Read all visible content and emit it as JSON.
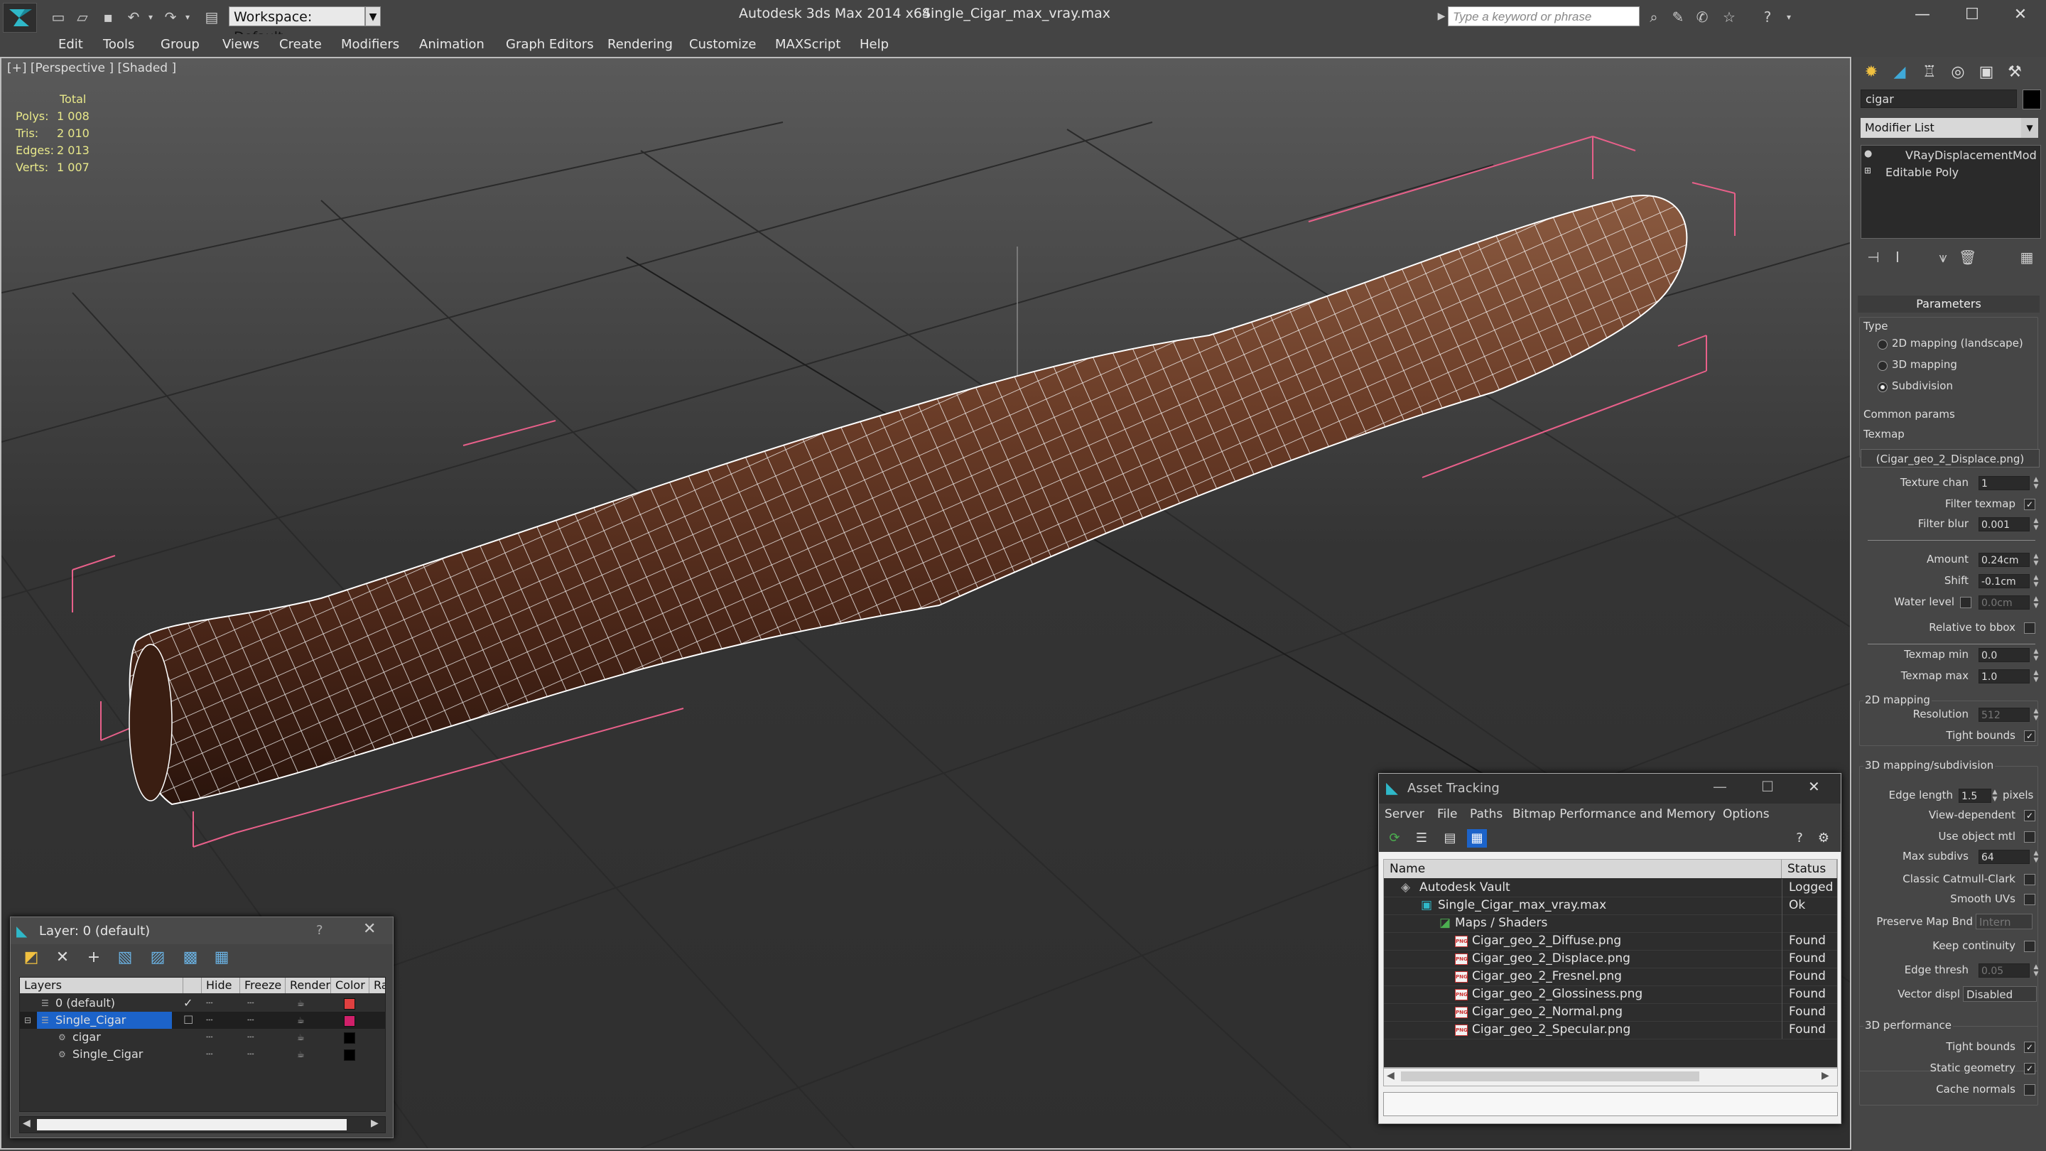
{
  "titlebar": {
    "workspace": "Workspace: Default",
    "app_title": "Autodesk 3ds Max  2014 x64",
    "file_title": "Single_Cigar_max_vray.max",
    "search_placeholder": "Type a keyword or phrase"
  },
  "menu": [
    "Edit",
    "Tools",
    "Group",
    "Views",
    "Create",
    "Modifiers",
    "Animation",
    "Graph Editors",
    "Rendering",
    "Customize",
    "MAXScript",
    "Help"
  ],
  "viewport": {
    "label": "[+] [Perspective ] [Shaded ]",
    "stats": {
      "header": "Total",
      "rows": [
        {
          "label": "Polys:",
          "value": "1 008"
        },
        {
          "label": "Tris:",
          "value": "2 010"
        },
        {
          "label": "Edges:",
          "value": "2 013"
        },
        {
          "label": "Verts:",
          "value": "1 007"
        }
      ]
    },
    "colors": {
      "selection_bracket": "#e8608a",
      "wire": "#ffffff",
      "cigar": "#5a3222"
    }
  },
  "command_panel": {
    "object_name": "cigar",
    "modifier_list": "Modifier List",
    "stack": [
      "VRayDisplacementMod",
      "Editable Poly"
    ],
    "parameters_title": "Parameters",
    "type_label": "Type",
    "type_options": [
      "2D mapping (landscape)",
      "3D mapping",
      "Subdivision"
    ],
    "type_selected": "Subdivision",
    "common_label": "Common params",
    "texmap_label": "Texmap",
    "texmap_value": "(Cigar_geo_2_Displace.png)",
    "texture_chan_label": "Texture chan",
    "texture_chan": "1",
    "filter_texmap_label": "Filter texmap",
    "filter_blur_label": "Filter blur",
    "filter_blur": "0.001",
    "amount_label": "Amount",
    "amount": "0.24cm",
    "shift_label": "Shift",
    "shift": "-0.1cm",
    "water_level_label": "Water level",
    "water_level": "0.0cm",
    "relative_bbox_label": "Relative to bbox",
    "texmap_min_label": "Texmap min",
    "texmap_min": "0.0",
    "texmap_max_label": "Texmap max",
    "texmap_max": "1.0",
    "map2d_label": "2D mapping",
    "resolution_label": "Resolution",
    "resolution": "512",
    "tight_bounds_label": "Tight bounds",
    "map3d_label": "3D mapping/subdivision",
    "edge_length_label": "Edge length",
    "edge_length": "1.5",
    "pixels_label": "pixels",
    "view_dependent_label": "View-dependent",
    "use_object_mtl_label": "Use object mtl",
    "max_subdivs_label": "Max subdivs",
    "max_subdivs": "64",
    "classic_cc_label": "Classic Catmull-Clark",
    "smooth_uvs_label": "Smooth UVs",
    "preserve_map_label": "Preserve Map Bnd",
    "preserve_map_value": "Intern",
    "keep_continuity_label": "Keep continuity",
    "edge_thresh_label": "Edge thresh",
    "edge_thresh": "0.05",
    "vector_displ_label": "Vector displ",
    "vector_displ_value": "Disabled",
    "perf3d_label": "3D performance",
    "perf_tight_bounds_label": "Tight bounds",
    "static_geometry_label": "Static geometry",
    "cache_normals_label": "Cache normals"
  },
  "layer_dialog": {
    "title": "Layer: 0 (default)",
    "help": "?",
    "columns": [
      "Layers",
      "Hide",
      "Freeze",
      "Render",
      "Color",
      "Radi"
    ],
    "rows": [
      {
        "name": "0 (default)",
        "color": "#e04040",
        "indent": 1,
        "selected": false
      },
      {
        "name": "Single_Cigar",
        "color": "#d0206a",
        "indent": 1,
        "selected": true
      },
      {
        "name": "cigar",
        "color": "#000000",
        "indent": 2,
        "selected": false
      },
      {
        "name": "Single_Cigar",
        "color": "#000000",
        "indent": 2,
        "selected": false
      }
    ]
  },
  "asset_tracking": {
    "title": "Asset Tracking",
    "menu": [
      "Server",
      "File",
      "Paths",
      "Bitmap Performance and Memory",
      "Options"
    ],
    "columns": [
      "Name",
      "Status"
    ],
    "rows": [
      {
        "name": "Autodesk Vault",
        "status": "Logged O",
        "indent": 0,
        "icon": "vault"
      },
      {
        "name": "Single_Cigar_max_vray.max",
        "status": "Ok",
        "indent": 1,
        "icon": "max"
      },
      {
        "name": "Maps / Shaders",
        "status": "",
        "indent": 2,
        "icon": "maps"
      },
      {
        "name": "Cigar_geo_2_Diffuse.png",
        "status": "Found",
        "indent": 3,
        "icon": "png"
      },
      {
        "name": "Cigar_geo_2_Displace.png",
        "status": "Found",
        "indent": 3,
        "icon": "png"
      },
      {
        "name": "Cigar_geo_2_Fresnel.png",
        "status": "Found",
        "indent": 3,
        "icon": "png"
      },
      {
        "name": "Cigar_geo_2_Glossiness.png",
        "status": "Found",
        "indent": 3,
        "icon": "png"
      },
      {
        "name": "Cigar_geo_2_Normal.png",
        "status": "Found",
        "indent": 3,
        "icon": "png"
      },
      {
        "name": "Cigar_geo_2_Specular.png",
        "status": "Found",
        "indent": 3,
        "icon": "png"
      }
    ]
  }
}
